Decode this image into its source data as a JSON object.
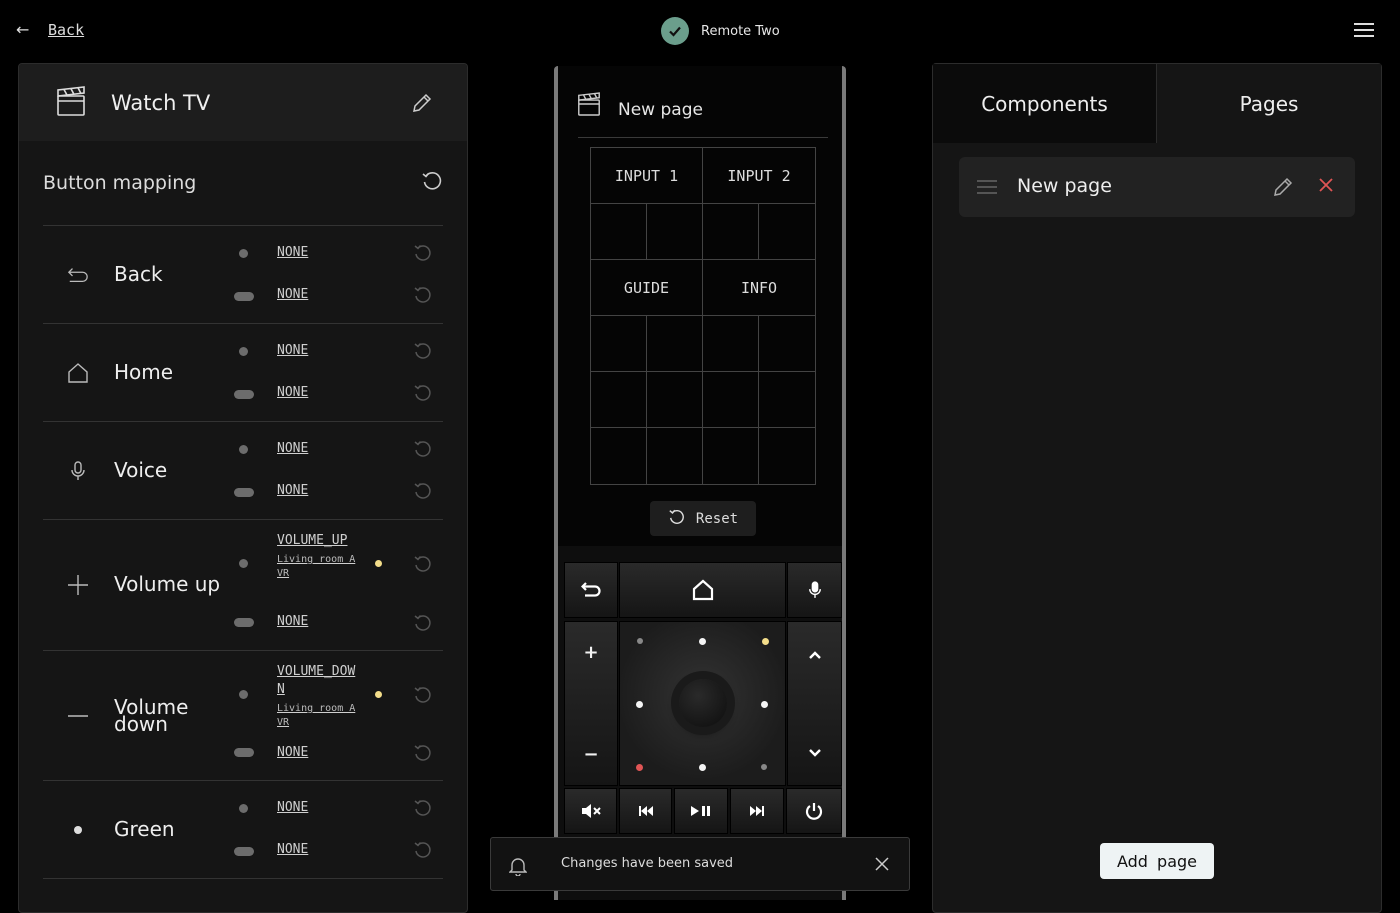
{
  "topbar": {
    "back_label": "Back",
    "remote_name": "Remote Two"
  },
  "activity": {
    "title": "Watch TV"
  },
  "button_mapping": {
    "title": "Button mapping",
    "rows": [
      {
        "name": "Back",
        "short_press": "NONE",
        "long_press": "NONE"
      },
      {
        "name": "Home",
        "short_press": "NONE",
        "long_press": "NONE"
      },
      {
        "name": "Voice",
        "short_press": "NONE",
        "long_press": "NONE"
      },
      {
        "name": "Volume up",
        "short_press": "VOLUME_UP",
        "short_press_entity": "Living room AVR",
        "long_press": "NONE"
      },
      {
        "name": "Volume down",
        "short_press": "VOLUME_DOWN",
        "short_press_entity": "Living room AVR",
        "long_press": "NONE"
      },
      {
        "name": "Green",
        "short_press": "NONE",
        "long_press": "NONE"
      }
    ]
  },
  "remote": {
    "page_name": "New page",
    "grid_buttons": {
      "input1": "INPUT 1",
      "input2": "INPUT 2",
      "guide": "GUIDE",
      "info": "INFO"
    },
    "reset_label": "Reset"
  },
  "toast": {
    "message": "Changes have been saved"
  },
  "right_panel": {
    "tabs": [
      "Components",
      "Pages"
    ],
    "active_tab": "Pages",
    "pages": [
      {
        "name": "New page"
      }
    ],
    "add_page_label": "Add page"
  },
  "colors": {
    "check_bg": "#6b9e8c",
    "indicator_yellow": "#f3dd8a",
    "indicator_red": "#e05555",
    "delete_red": "#e05555"
  }
}
